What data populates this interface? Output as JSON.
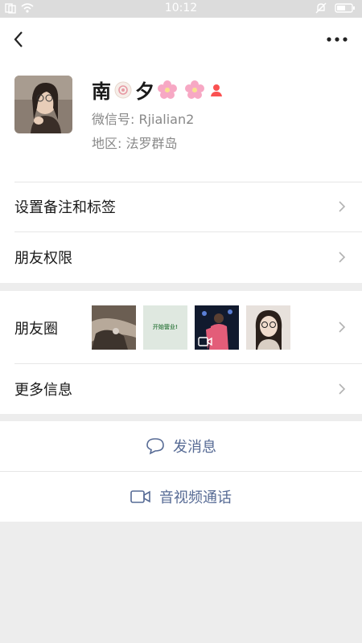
{
  "status_bar": {
    "time": "10:12"
  },
  "profile": {
    "name_prefix": "南",
    "name_mid": "夕",
    "wechat_id": "微信号: Rjialian2",
    "region": "地区: 法罗群岛"
  },
  "rows": {
    "remark_tags": "设置备注和标签",
    "friend_permissions": "朋友权限",
    "moments": "朋友圈",
    "more_info": "更多信息"
  },
  "moments_thumb_text": "开始营业!",
  "actions": {
    "send_message": "发消息",
    "video_call": "音视频通话"
  },
  "colors": {
    "link_blue": "#576b95",
    "bg_gray": "#ededed"
  }
}
